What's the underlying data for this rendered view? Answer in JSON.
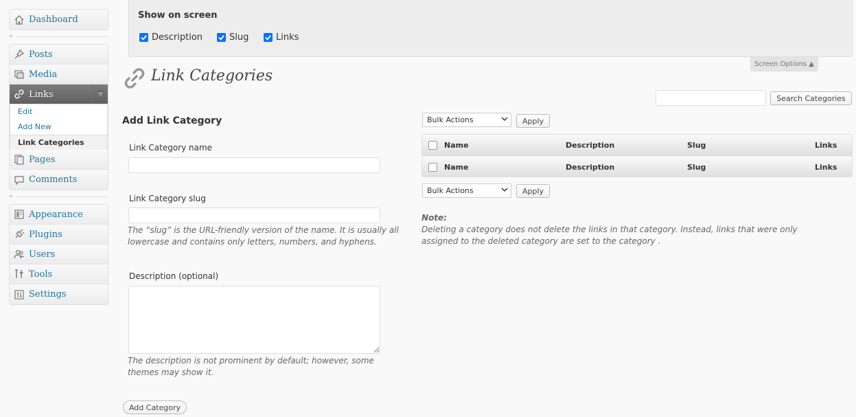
{
  "sidebar": {
    "dashboard": "Dashboard",
    "posts": "Posts",
    "media": "Media",
    "links": "Links",
    "links_sub": [
      "Edit",
      "Add New",
      "Link Categories"
    ],
    "pages": "Pages",
    "comments": "Comments",
    "appearance": "Appearance",
    "plugins": "Plugins",
    "users": "Users",
    "tools": "Tools",
    "settings": "Settings"
  },
  "screen_options": {
    "heading": "Show on screen",
    "options": [
      "Description",
      "Slug",
      "Links"
    ],
    "tab_label": "Screen Options ▲"
  },
  "page_title": "Link Categories",
  "search": {
    "value": "",
    "button": "Search Categories"
  },
  "form": {
    "title": "Add Link Category",
    "name_label": "Link Category name",
    "name_value": "",
    "slug_label": "Link Category slug",
    "slug_value": "",
    "slug_hint": "The “slug” is the URL-friendly version of the name. It is usually all lowercase and contains only letters, numbers, and hyphens.",
    "desc_label": "Description (optional)",
    "desc_value": "",
    "desc_hint": "The description is not prominent by default; however, some themes may show it.",
    "submit": "Add Category"
  },
  "bulk": {
    "select": "Bulk Actions",
    "apply": "Apply"
  },
  "table": {
    "columns": [
      "Name",
      "Description",
      "Slug",
      "Links"
    ]
  },
  "note": {
    "title": "Note:",
    "text": "Deleting a category does not delete the links in that category. Instead, links that were only assigned to the deleted category are set to the category ."
  }
}
